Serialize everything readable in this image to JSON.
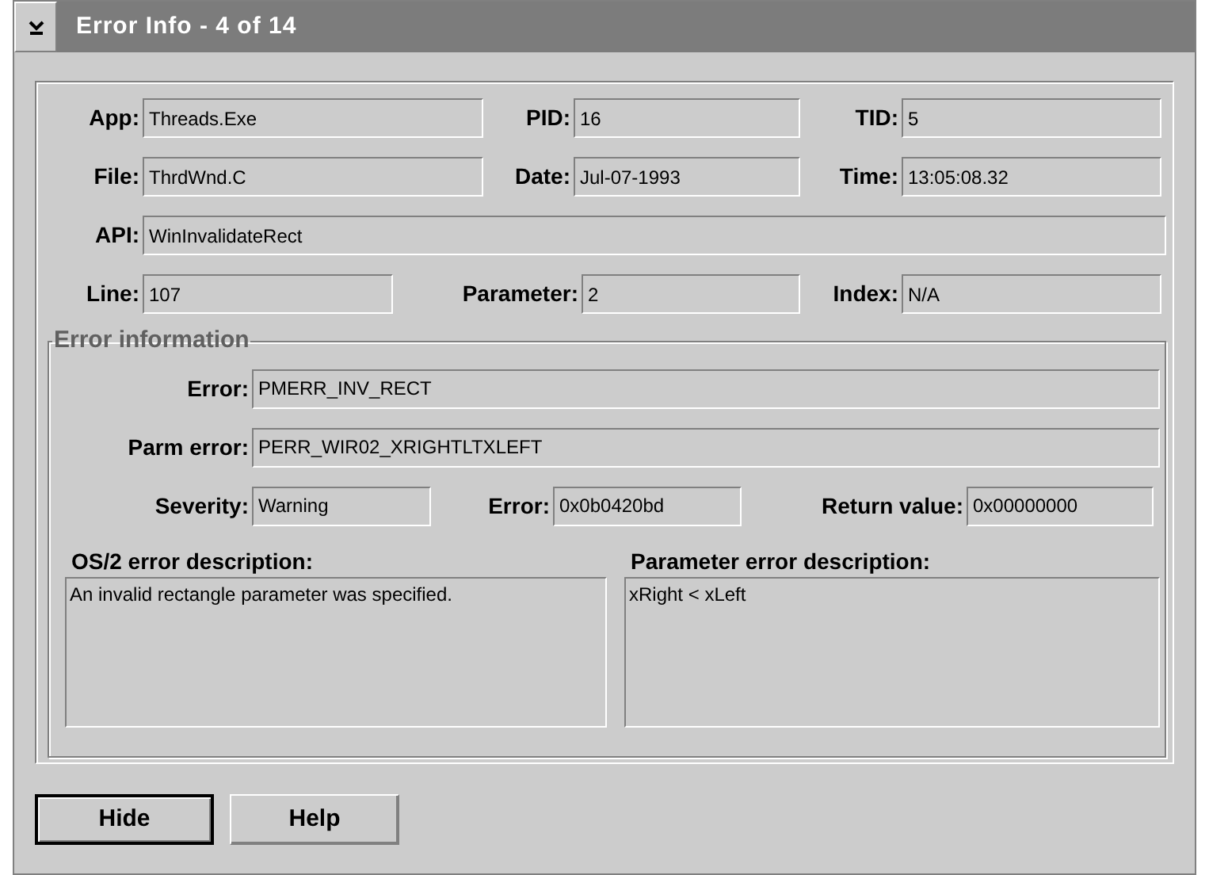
{
  "window": {
    "title": "Error Info - 4 of 14"
  },
  "rows": [
    [
      {
        "label": "App:",
        "value": "Threads.Exe"
      },
      {
        "label": "PID:",
        "value": "16"
      },
      {
        "label": "TID:",
        "value": "5"
      }
    ],
    [
      {
        "label": "File:",
        "value": "ThrdWnd.C"
      },
      {
        "label": "Date:",
        "value": "Jul-07-1993"
      },
      {
        "label": "Time:",
        "value": "13:05:08.32"
      }
    ],
    [
      {
        "label": "API:",
        "value": "WinInvalidateRect"
      }
    ],
    [
      {
        "label": "Line:",
        "value": "107"
      },
      {
        "label": "Parameter:",
        "value": "2"
      },
      {
        "label": "Index:",
        "value": "N/A"
      }
    ]
  ],
  "error_information": {
    "title": "Error information",
    "rows": [
      [
        {
          "label": "Error:",
          "value": "PMERR_INV_RECT"
        }
      ],
      [
        {
          "label": "Parm error:",
          "value": "PERR_WIR02_XRIGHTLTXLEFT"
        }
      ],
      [
        {
          "label": "Severity:",
          "value": "Warning"
        },
        {
          "label": "Error:",
          "value": "0x0b0420bd"
        },
        {
          "label": "Return value:",
          "value": "0x00000000"
        }
      ]
    ],
    "descriptions": [
      {
        "label": "OS/2 error description:",
        "text": "An invalid rectangle parameter was specified."
      },
      {
        "label": "Parameter error description:",
        "text": "xRight < xLeft"
      }
    ]
  },
  "buttons": [
    {
      "label": "Hide",
      "default": true
    },
    {
      "label": "Help",
      "default": false
    }
  ]
}
